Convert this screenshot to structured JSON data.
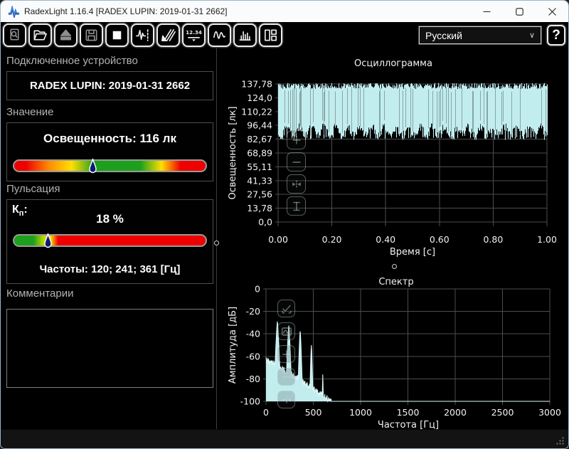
{
  "window": {
    "title": "RadexLight 1.16.4 [RADEX LUPIN: 2019-01-31 2662]",
    "controls": [
      "minimize",
      "maximize",
      "close"
    ]
  },
  "toolbar": {
    "buttons": [
      {
        "name": "preview",
        "enabled": false
      },
      {
        "name": "open-file",
        "enabled": true
      },
      {
        "name": "eject-device",
        "enabled": false
      },
      {
        "name": "save",
        "enabled": false
      },
      {
        "name": "stop-measurement",
        "enabled": true
      },
      {
        "name": "measurement-mode",
        "enabled": true
      },
      {
        "name": "clear-sweep",
        "enabled": true
      },
      {
        "name": "numeric-view",
        "enabled": true
      },
      {
        "name": "oscillogram-view",
        "enabled": true
      },
      {
        "name": "spectrum-view",
        "enabled": true
      },
      {
        "name": "layout-view",
        "enabled": true
      }
    ],
    "language_select": {
      "value": "Русский"
    },
    "help_label": "?"
  },
  "left_panel": {
    "device": {
      "label": "Подключенное устройство",
      "name": "RADEX LUPIN: 2019-01-31 2662"
    },
    "value": {
      "label": "Значение",
      "reading": "Освещенность: 116 лк",
      "indicator_pct": 41
    },
    "pulsation": {
      "label": "Пульсация",
      "kp_main": "К",
      "kp_sub": "п",
      "kp_colon": ":",
      "value": "18 %",
      "indicator_pct": 17.5,
      "frequencies": "Частоты: 120; 241; 361 [Гц]"
    },
    "comments": {
      "label": "Комментарии",
      "text": ""
    }
  },
  "chart_data": [
    {
      "type": "area",
      "title": "Осциллограмма",
      "xlabel": "Время [с]",
      "ylabel": "Освещенность [лк]",
      "xlim": [
        0,
        1
      ],
      "ylim": [
        0,
        137.78
      ],
      "grid": true,
      "series_color": "#c2edef",
      "x_ticks": [
        "0.00",
        "0.20",
        "0.40",
        "0.60",
        "0.80",
        "1.00"
      ],
      "y_ticks": [
        "137,78",
        "124,0",
        "110,22",
        "96,44",
        "82,67",
        "68,89",
        "55,11",
        "41,33",
        "27,56",
        "13,78",
        "0,0"
      ],
      "waveform": {
        "description": "pulsating illuminance signal, dense band",
        "min_lux": 88,
        "max_lux": 137.78,
        "mean_lux": 116,
        "pulse_frequency_hz": 120,
        "duration_s": 1
      }
    },
    {
      "type": "area",
      "title": "Спектр",
      "xlabel": "Частота [Гц]",
      "ylabel": "Амплитуда [дБ]",
      "xlim": [
        0,
        3000
      ],
      "ylim": [
        -100,
        0
      ],
      "grid": true,
      "series_color": "#c2edef",
      "x_ticks": [
        "0",
        "500",
        "1000",
        "1500",
        "2000",
        "2500",
        "3000"
      ],
      "y_ticks": [
        "0",
        "-20",
        "-40",
        "-60",
        "-80",
        "-100"
      ],
      "peaks": [
        {
          "freq_hz": 120,
          "amp_db": -29,
          "width_hz": 26
        },
        {
          "freq_hz": 241,
          "amp_db": -32,
          "width_hz": 24
        },
        {
          "freq_hz": 361,
          "amp_db": -37,
          "width_hz": 20
        },
        {
          "freq_hz": 480,
          "amp_db": -50,
          "width_hz": 16
        },
        {
          "freq_hz": 600,
          "amp_db": -76,
          "width_hz": 9
        }
      ],
      "noise_floor": {
        "start_db": -63,
        "end_db": -100,
        "cutoff_hz": 690
      }
    }
  ],
  "chart_buttons": {
    "oscillogram": [
      "zoom-in",
      "zoom-out",
      "fit-horizontal",
      "fit-vertical"
    ],
    "spectrum": [
      "autoscale-check",
      "smooth-wave",
      "zoom-in",
      "zoom-out",
      "fit-horizontal"
    ]
  }
}
